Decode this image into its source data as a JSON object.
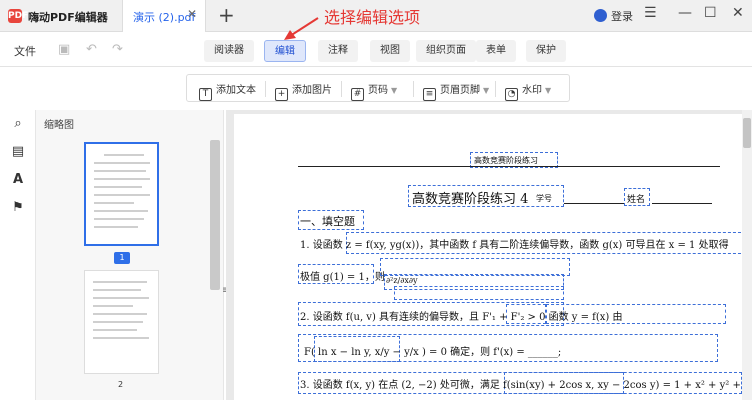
{
  "titlebar": {
    "app_logo": "PDF",
    "app_name": "嗨动PDF编辑器",
    "file_tab": "演示 (2).pdf",
    "close_tab": "✕",
    "new_tab": "+",
    "annotation": "选择编辑选项",
    "login": "登录",
    "win_menu": "☰",
    "win_min": "—",
    "win_max": "☐",
    "win_close": "✕"
  },
  "menu": {
    "file": "文件",
    "tabs": [
      "阅读器",
      "编辑",
      "注释",
      "视图",
      "组织页面",
      "表单",
      "保护"
    ],
    "active_tab": "编辑"
  },
  "edit_toolbar": {
    "add_text": "添加文本",
    "add_image": "添加图片",
    "page_num": "页码",
    "header_footer": "页眉页脚",
    "watermark": "水印"
  },
  "sidebar": {
    "title": "缩略图",
    "pages": [
      "1",
      "2"
    ]
  },
  "doc": {
    "header": "高数竞赛阶段练习",
    "title": "高数竞赛阶段练习 4",
    "student_id": "学号",
    "name": "姓名",
    "section": "一、填空题",
    "q1a": "1. 设函数 z = f(xy, yg(x))，其中函数 f 具有二阶连续偏导数，函数 g(x) 可导且在 x = 1 处取得",
    "q1b": "极值 g(1) = 1，则",
    "q1c": "∂²z/∂x∂y",
    "q2a": "2. 设函数 f(u, v) 具有连续的偏导数，且 F'₁ + F'₂ > 0    函数 y = f(x) 由",
    "q2b": "F( ln x − ln y,  x/y − y/x ) = 0 确定，则 f'(x) = ______;",
    "q3a": "3. 设函数 f(x, y) 在点 (2, −2) 处可微，满足 f(sin(xy) + 2cos x, xy − 2cos y) = 1 + x² + y² +"
  }
}
